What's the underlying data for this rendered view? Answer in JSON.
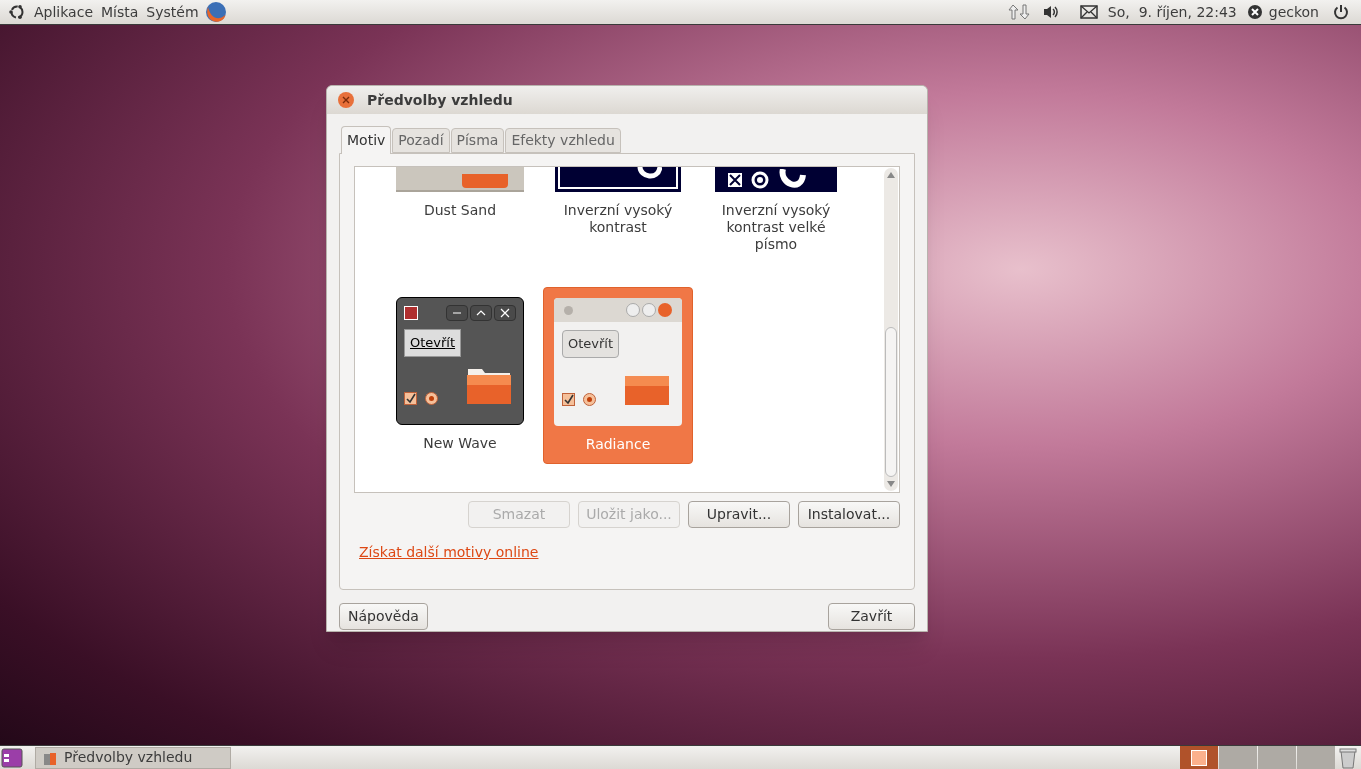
{
  "top_panel": {
    "menus": [
      "Aplikace",
      "Místa",
      "Systém"
    ],
    "clock": "So,  9. říjen, 22:43",
    "user": "geckon"
  },
  "dialog": {
    "title": "Předvolby vzhledu",
    "tabs": [
      {
        "label": "Motiv",
        "selected": true
      },
      {
        "label": "Pozadí",
        "selected": false
      },
      {
        "label": "Písma",
        "selected": false
      },
      {
        "label": "Efekty vzhledu",
        "selected": false
      }
    ],
    "themes": [
      {
        "name": "Dust Sand",
        "kind": "sand",
        "selected": false
      },
      {
        "name": "Inverzní vysoký kontrast",
        "kind": "contrast",
        "selected": false
      },
      {
        "name": "Inverzní vysoký kontrast velké písmo",
        "kind": "contrast-large",
        "selected": false
      },
      {
        "name": "New Wave",
        "kind": "newwave",
        "selected": false,
        "preview_button": "Otevřít",
        "checked": true
      },
      {
        "name": "Radiance",
        "kind": "radiance",
        "selected": true,
        "preview_button": "Otevřít",
        "checked": true
      }
    ],
    "actions": [
      {
        "label": "Smazat",
        "disabled": true
      },
      {
        "label": "Uložit jako...",
        "disabled": true
      },
      {
        "label": "Upravit...",
        "disabled": false
      },
      {
        "label": "Instalovat...",
        "disabled": false
      }
    ],
    "link": "Získat další motivy online",
    "help_button": "Nápověda",
    "close_button": "Zavřít"
  },
  "bottom_panel": {
    "task": "Předvolby vzhledu",
    "workspaces": [
      {
        "selected": true
      },
      {
        "selected": false
      },
      {
        "selected": false
      },
      {
        "selected": false
      }
    ]
  }
}
